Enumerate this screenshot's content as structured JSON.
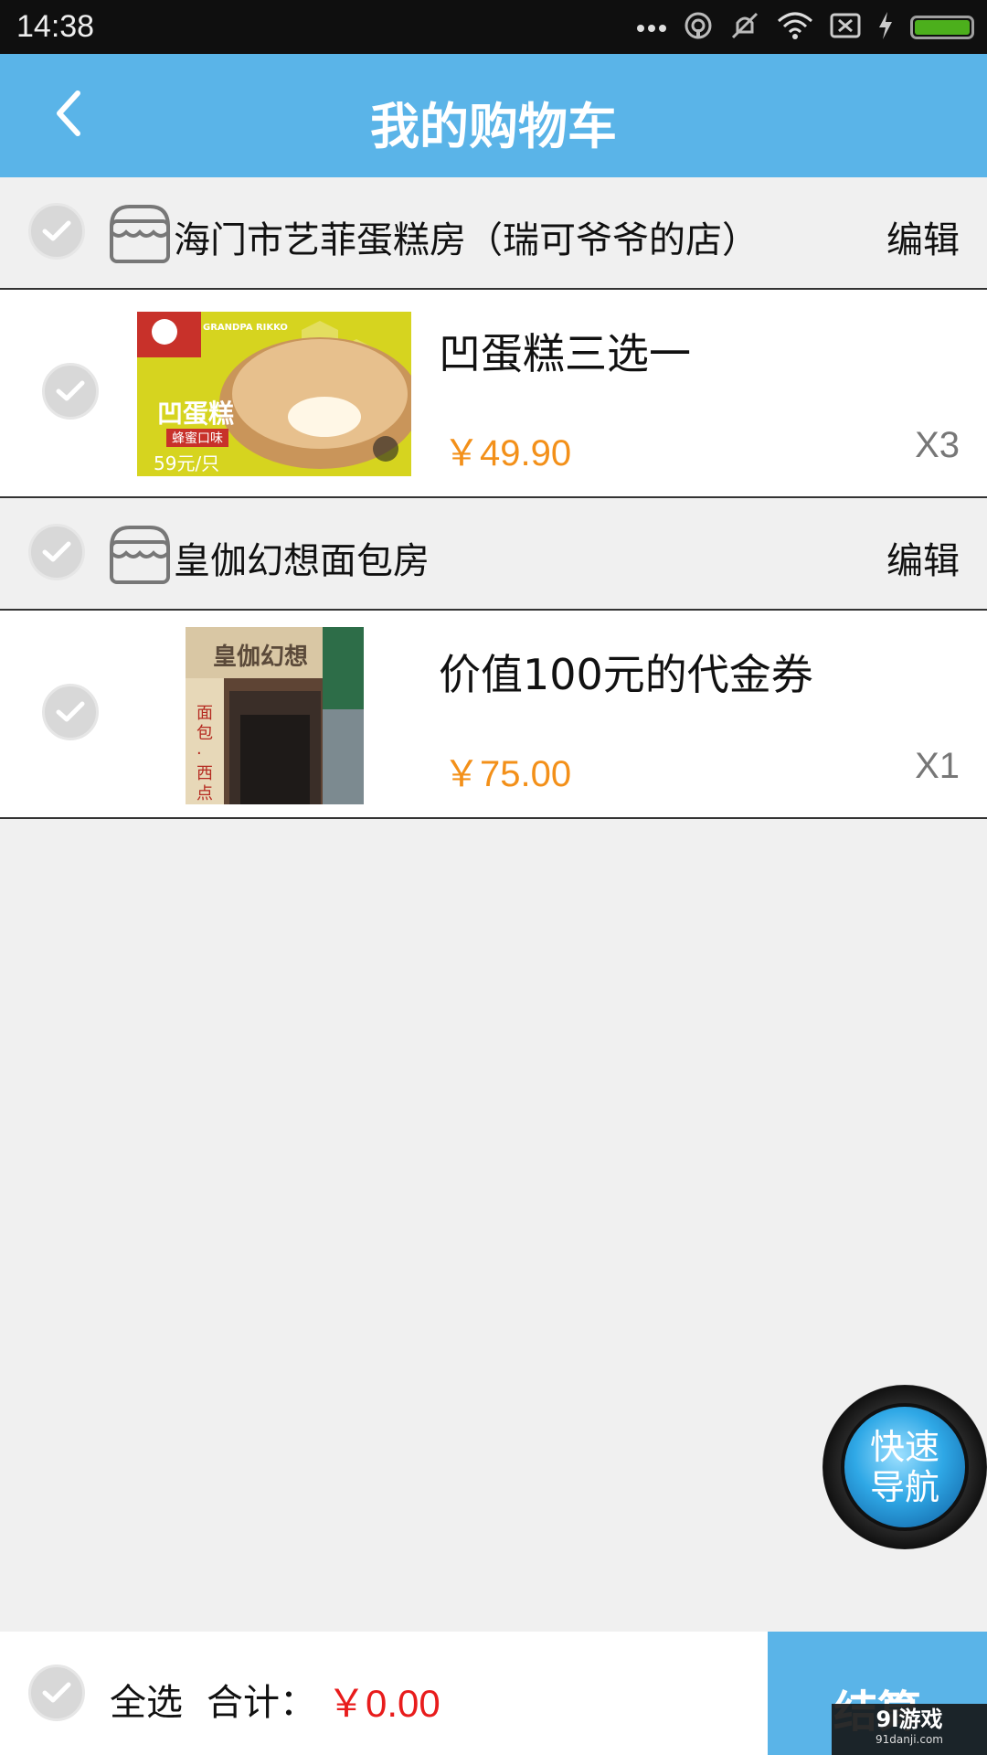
{
  "status_bar": {
    "time": "14:38",
    "icons": [
      "more-icon",
      "hotspot-icon",
      "mute-icon",
      "wifi-icon",
      "no-sim-icon",
      "charging-icon",
      "battery-icon"
    ]
  },
  "header": {
    "title": "我的购物车",
    "back_icon": "chevron-left-icon"
  },
  "shops": [
    {
      "name": "海门市艺菲蛋糕房（瑞可爷爷的店）",
      "edit_label": "编辑",
      "items": [
        {
          "name": "凹蛋糕三选一",
          "price": "￥49.90",
          "qty": "X3",
          "image_text": {
            "brand": "GRANDPA RIKKO",
            "tag": "凹蛋糕",
            "sub": "蜂蜜口味",
            "price_tag": "59元/只"
          }
        }
      ]
    },
    {
      "name": "皇伽幻想面包房",
      "edit_label": "编辑",
      "items": [
        {
          "name": "价值100元的代金券",
          "price": "￥75.00",
          "qty": "X1",
          "image_text": {
            "sign": "皇伽幻想",
            "side": "面包·西点·蛋"
          }
        }
      ]
    }
  ],
  "fab": {
    "line1": "快速",
    "line2": "导航"
  },
  "bottom_bar": {
    "select_all": "全选",
    "total_label": "合计：",
    "total_value": "￥0.00",
    "checkout": "结算"
  },
  "watermark": {
    "text": "9l游戏",
    "sub": "91danji.com"
  },
  "colors": {
    "header": "#5ab4e8",
    "price": "#f39019",
    "total": "#e81c1c",
    "background": "#f0f0f0"
  }
}
